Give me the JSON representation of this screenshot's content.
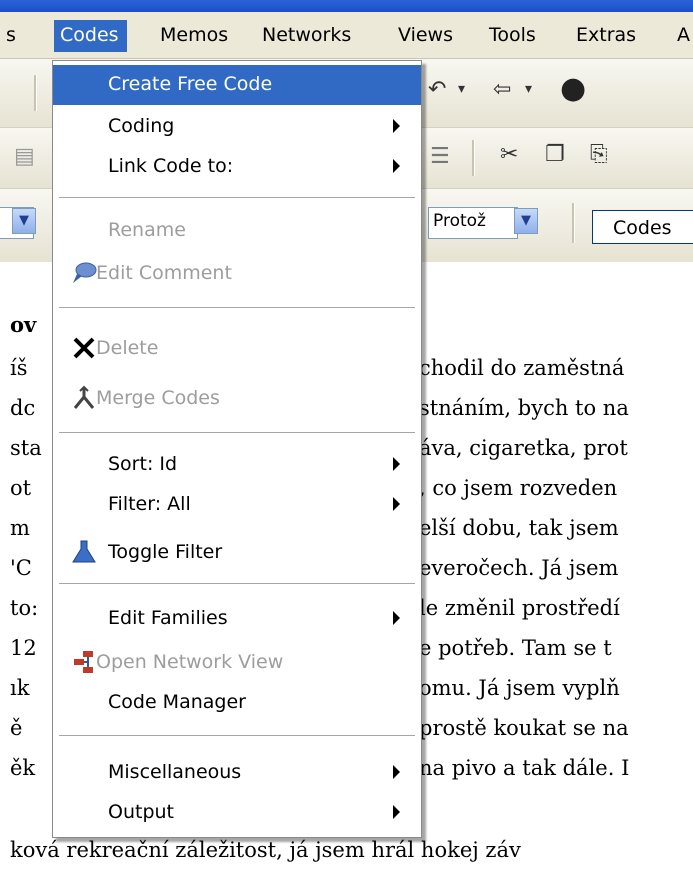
{
  "menubar": {
    "items": [
      {
        "label": "s",
        "active": false
      },
      {
        "label": "Codes",
        "active": true
      },
      {
        "label": "Memos",
        "active": false
      },
      {
        "label": "Networks",
        "active": false
      },
      {
        "label": "Views",
        "active": false
      },
      {
        "label": "Tools",
        "active": false
      },
      {
        "label": "Extras",
        "active": false
      },
      {
        "label": "A",
        "active": false
      }
    ]
  },
  "toolbar": {
    "combo1_value": "Protož",
    "codes_button": "Codes"
  },
  "context_menu": {
    "items": [
      {
        "label": "Create Free Code",
        "selected": true,
        "disabled": false,
        "submenu": false,
        "icon": null
      },
      {
        "label": "Coding",
        "selected": false,
        "disabled": false,
        "submenu": true,
        "icon": null
      },
      {
        "label": "Link Code to:",
        "selected": false,
        "disabled": false,
        "submenu": true,
        "icon": null
      },
      {
        "label": "Rename",
        "selected": false,
        "disabled": true,
        "submenu": false,
        "icon": null
      },
      {
        "label": "Edit Comment",
        "selected": false,
        "disabled": true,
        "submenu": false,
        "icon": "speech-bubble-icon"
      },
      {
        "label": "Delete",
        "selected": false,
        "disabled": true,
        "submenu": false,
        "icon": "x-icon"
      },
      {
        "label": "Merge Codes",
        "selected": false,
        "disabled": true,
        "submenu": false,
        "icon": "merge-icon"
      },
      {
        "label": "Sort: Id",
        "selected": false,
        "disabled": false,
        "submenu": true,
        "icon": null
      },
      {
        "label": "Filter: All",
        "selected": false,
        "disabled": false,
        "submenu": true,
        "icon": null
      },
      {
        "label": "Toggle Filter",
        "selected": false,
        "disabled": false,
        "submenu": false,
        "icon": "flask-icon"
      },
      {
        "label": "Edit Families",
        "selected": false,
        "disabled": false,
        "submenu": true,
        "icon": null
      },
      {
        "label": "Open Network View",
        "selected": false,
        "disabled": true,
        "submenu": false,
        "icon": "network-icon"
      },
      {
        "label": "Code Manager",
        "selected": false,
        "disabled": false,
        "submenu": false,
        "icon": null
      },
      {
        "label": "Miscellaneous",
        "selected": false,
        "disabled": false,
        "submenu": true,
        "icon": null
      },
      {
        "label": "Output",
        "selected": false,
        "disabled": false,
        "submenu": true,
        "icon": null
      }
    ]
  },
  "document": {
    "left_fragments": [
      "ov",
      "íš",
      "dc",
      "sta",
      "ot",
      "m",
      "'C",
      "to:",
      "12",
      "ık",
      "ě",
      "ěk",
      "ková rekreační záležitost, já jsem hrál hokej záv"
    ],
    "right_fragments": [
      "chodil do zaměstná",
      "stnáním, bych to na",
      "áva, cigaretka, prot",
      ", co jsem rozveden",
      "elší dobu, tak jsem",
      "everočech. Já jsem",
      "le změnil prostředí",
      "e potřeb. Tam se t",
      "omu. Já jsem vyplň",
      "prostě koukat se na",
      "na pivo a tak dále. I"
    ]
  },
  "colors": {
    "menu_highlight": "#316ac5",
    "xp_titlebar": "#1b4fc9",
    "toolbar_bg": "#ece9d8"
  }
}
